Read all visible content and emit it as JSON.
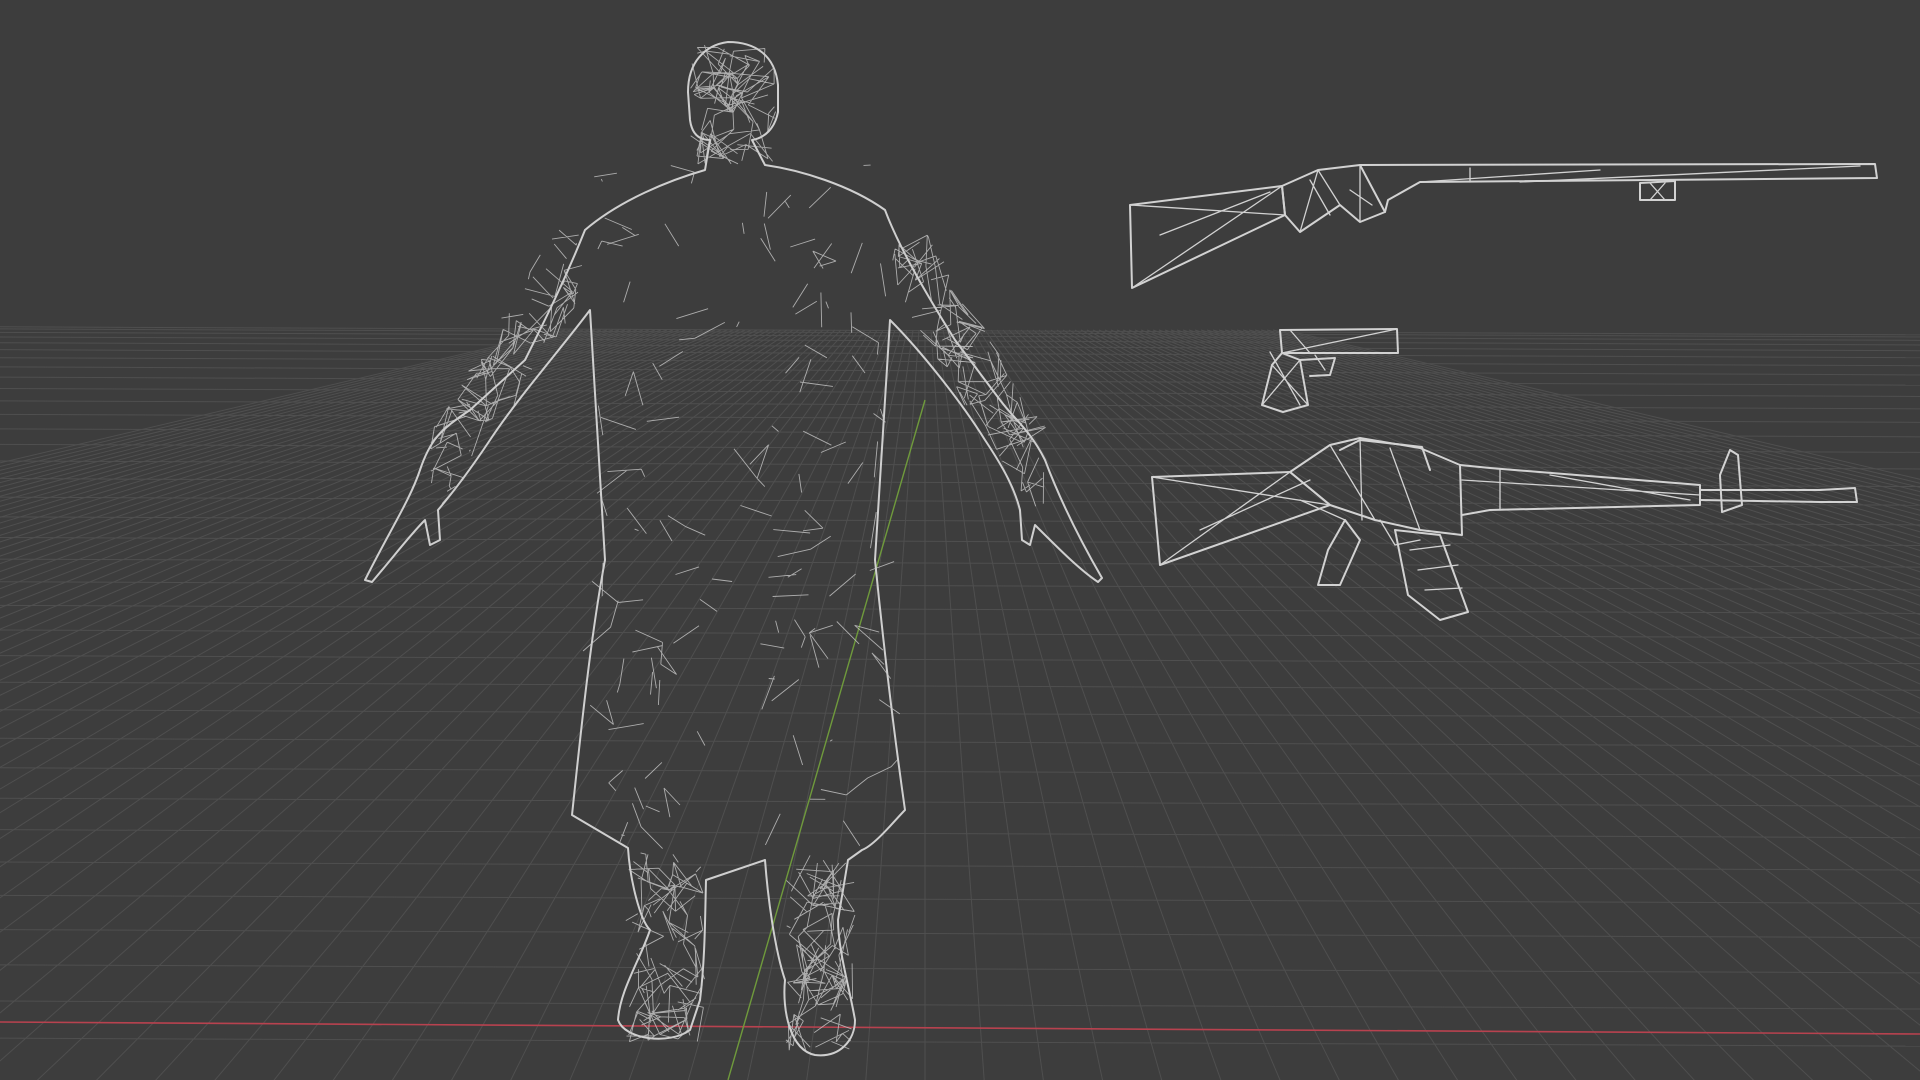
{
  "viewport": {
    "mode": "wireframe",
    "background_color": "#3d3d3d",
    "grid_color": "#4f4f4f",
    "wire_color": "#c9c9c9",
    "x_axis_color": "#b8424f",
    "y_axis_color": "#6f9a3c"
  },
  "objects": [
    {
      "name": "character-coat-figure"
    },
    {
      "name": "shotgun"
    },
    {
      "name": "pistol"
    },
    {
      "name": "assault-rifle"
    }
  ]
}
